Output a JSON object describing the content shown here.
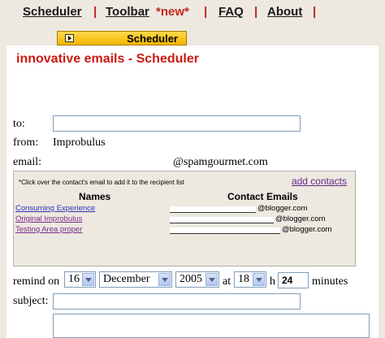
{
  "nav": {
    "items": [
      {
        "label": "Scheduler"
      },
      {
        "label": "Toolbar",
        "new": "*new*"
      },
      {
        "label": "FAQ"
      },
      {
        "label": "About"
      }
    ],
    "separator": "|"
  },
  "tab": {
    "label": "Scheduler"
  },
  "page": {
    "title": "innovative emails - Scheduler"
  },
  "form": {
    "to_label": "to:",
    "to_value": "",
    "from_label": "from:",
    "from_value": "Improbulus",
    "email_label": "email:",
    "email_domain": "@spamgourmet.com",
    "remind_label": "remind on",
    "day": "16",
    "month": "December",
    "year": "2005",
    "at_label": "at",
    "hour": "18",
    "h_label": "h",
    "minutes": "24",
    "minutes_label": "minutes",
    "subject_label": "subject:",
    "subject_value": "",
    "body_value": ""
  },
  "contacts": {
    "hint": "*Click over the contact's email to add it to the recipient list",
    "add_label": "add contacts",
    "col_names": "Names",
    "col_emails": "Contact Emails",
    "rows": [
      {
        "name": "Consuming Experience",
        "domain": "@blogger.com"
      },
      {
        "name": "Original Improbulus",
        "domain": "@blogger.com"
      },
      {
        "name": "Testing Area proper",
        "domain": "@blogger.com"
      }
    ]
  },
  "colors": {
    "title": "#cc1a12",
    "nav_pipe": "#b8261a",
    "name_link_blue": "#2b35b8",
    "name_link_purple": "#7a2a8a",
    "tab_bg": "#f2b400"
  }
}
